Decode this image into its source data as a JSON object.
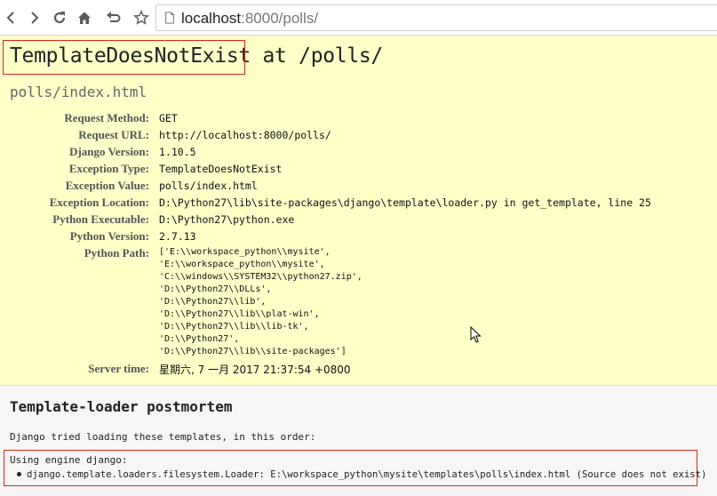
{
  "browser": {
    "url_host": "localhost",
    "url_path": ":8000/polls/",
    "nav_icons": [
      "back-icon",
      "forward-icon",
      "reload-icon",
      "home-icon",
      "undo-icon",
      "star-icon",
      "page-icon"
    ]
  },
  "error": {
    "title_exception": "TemplateDoesNotExist",
    "title_rest": " at /polls/",
    "subtitle": "polls/index.html",
    "highlight_color": "#d9261c",
    "background_color": "#ffffc8"
  },
  "meta": [
    {
      "label": "Request Method:",
      "value": "GET"
    },
    {
      "label": "Request URL:",
      "value": "http://localhost:8000/polls/"
    },
    {
      "label": "Django Version:",
      "value": "1.10.5"
    },
    {
      "label": "Exception Type:",
      "value": "TemplateDoesNotExist"
    },
    {
      "label": "Exception Value:",
      "value": "polls/index.html"
    },
    {
      "label": "Exception Location:",
      "value": "D:\\Python27\\lib\\site-packages\\django\\template\\loader.py in get_template, line 25"
    },
    {
      "label": "Python Executable:",
      "value": "D:\\Python27\\python.exe"
    },
    {
      "label": "Python Version:",
      "value": "2.7.13"
    },
    {
      "label": "Python Path:",
      "value": ""
    },
    {
      "label": "Server time:",
      "value": "星期六, 7 一月 2017 21:37:54 +0800"
    }
  ],
  "python_path": [
    "['E:\\\\workspace_python\\\\mysite',",
    " 'E:\\\\workspace_python\\\\mysite',",
    " 'C:\\\\windows\\\\SYSTEM32\\\\python27.zip',",
    " 'D:\\\\Python27\\\\DLLs',",
    " 'D:\\\\Python27\\\\lib',",
    " 'D:\\\\Python27\\\\lib\\\\plat-win',",
    " 'D:\\\\Python27\\\\lib\\\\lib-tk',",
    " 'D:\\\\Python27',",
    " 'D:\\\\Python27\\\\lib\\\\site-packages']"
  ],
  "postmortem": {
    "title": "Template-loader postmortem",
    "intro": "Django tried loading these templates, in this order:",
    "engine": "Using engine django:",
    "item": "django.template.loaders.filesystem.Loader: E:\\workspace_python\\mysite\\templates\\polls\\index.html (Source does not exist)"
  }
}
